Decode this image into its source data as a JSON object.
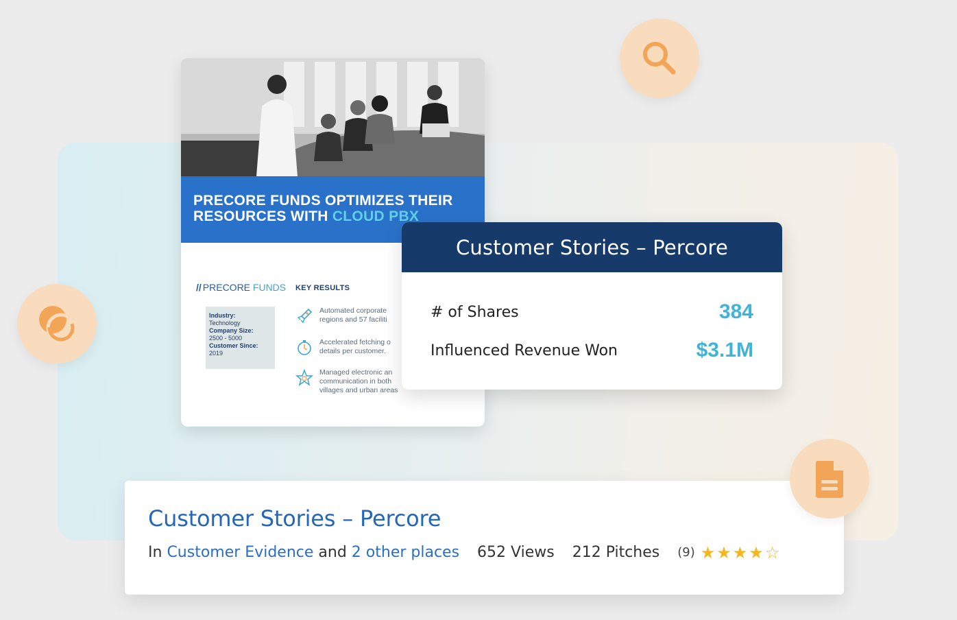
{
  "document": {
    "banner_line1": "PRECORE FUNDS OPTIMIZES THEIR",
    "banner_line2_prefix": "RESOURCES WITH ",
    "banner_line2_highlight": "CLOUD PBX",
    "brand_slash": "//",
    "brand_bold": "PRECORE",
    "brand_thin": " FUNDS",
    "key_results_heading": "KEY RESULTS",
    "info": {
      "industry_label": "Industry:",
      "industry_value": "Technology",
      "size_label": "Company Size:",
      "size_value": "2500 - 5000",
      "since_label": "Customer Since:",
      "since_value": "2019"
    },
    "results": [
      {
        "icon": "rocket-icon",
        "text": "Automated corporate\nregions and 57 faciliti"
      },
      {
        "icon": "stopwatch-icon",
        "text": "Accelerated fetching o\ndetails per customer."
      },
      {
        "icon": "star-badge-icon",
        "text": "Managed electronic an\ncommunication in both\nvillages and urban areas"
      }
    ]
  },
  "stats_card": {
    "title": "Customer Stories – Percore",
    "rows": [
      {
        "label": "# of Shares",
        "value": "384"
      },
      {
        "label": "Influenced Revenue Won",
        "value": "$3.1M"
      }
    ]
  },
  "listing": {
    "title": "Customer Stories – Percore",
    "in_prefix": "In",
    "location_link": "Customer Evidence",
    "and_text": "and",
    "other_places_link": "2 other places",
    "views": "652 Views",
    "pitches": "212  Pitches",
    "rating_count": "(9)",
    "rating": 4,
    "rating_max": 5
  },
  "icons": {
    "search": "search-icon",
    "overlap": "overlap-circles-icon",
    "document": "document-icon"
  },
  "colors": {
    "accent_blue": "#2467b8",
    "navy": "#163a6a",
    "cyan": "#3fb4d8",
    "peach": "#f9dcbd",
    "orange_icon": "#f3a557",
    "star": "#f4b71e"
  }
}
